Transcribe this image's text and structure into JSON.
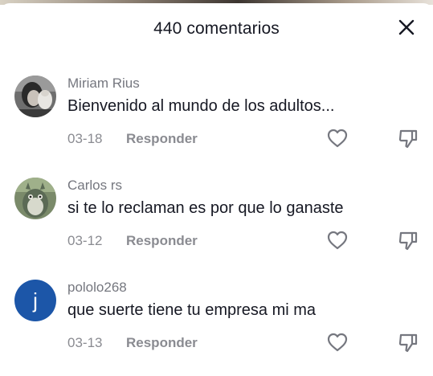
{
  "header": {
    "title": "440 comentarios",
    "close_icon": "close-icon"
  },
  "reply_label": "Responder",
  "comments": [
    {
      "username": "Miriam Rius",
      "text": "Bienvenido al mundo de los adultos...",
      "date": "03-18",
      "avatar": "photo"
    },
    {
      "username": "Carlos rs",
      "text": "si te lo reclaman es por que lo ganaste",
      "date": "03-12",
      "avatar": "photo"
    },
    {
      "username": "pololo268",
      "text": "que suerte tiene tu empresa mi ma",
      "date": "03-13",
      "avatar_letter": "j",
      "avatar_color": "#1c56a8"
    }
  ],
  "icons": {
    "like": "heart-outline-icon",
    "dislike": "thumbs-down-icon"
  }
}
